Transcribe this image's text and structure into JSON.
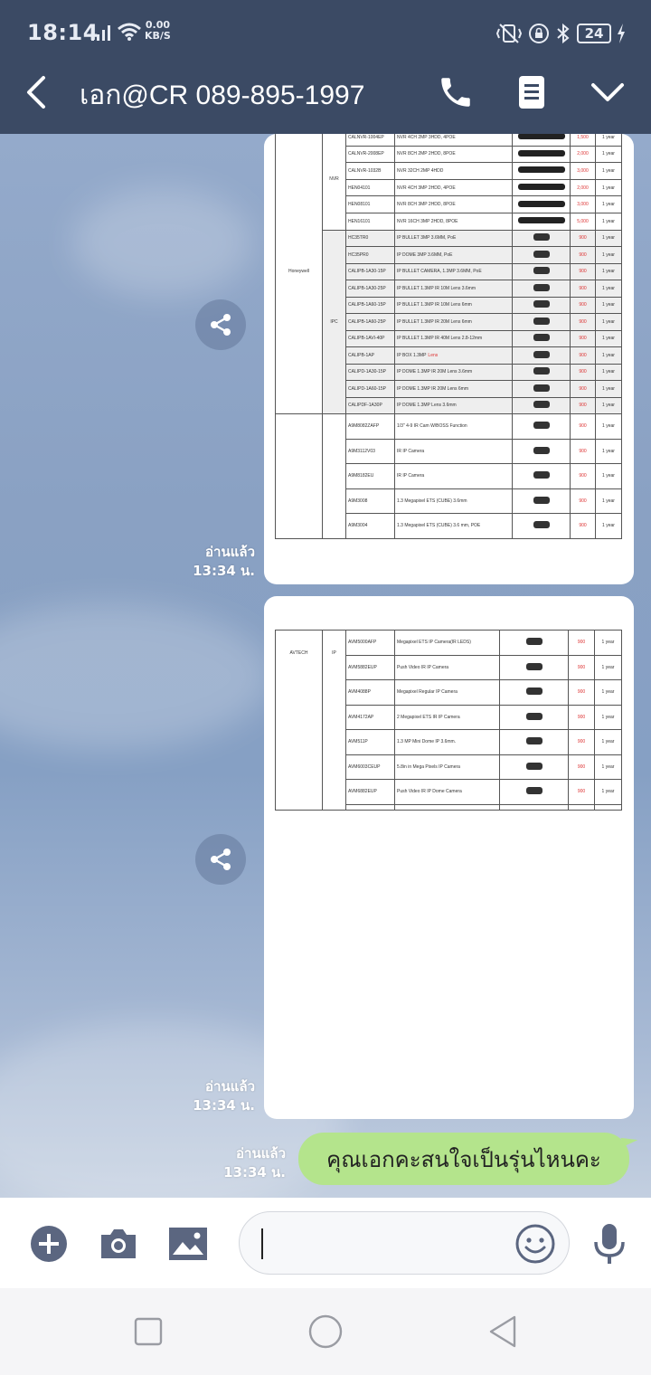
{
  "status": {
    "time": "18:14",
    "speed_value": "0.00",
    "speed_unit": "KB/S",
    "battery": "24"
  },
  "header": {
    "title": "เอก@CR 089-895-1997"
  },
  "messages": [
    {
      "type": "image",
      "read_label": "อ่านแล้ว",
      "time": "13:34 น.",
      "doc": {
        "brand": "Honeywell",
        "group_nvr": "NVR",
        "group_ipc": "IPC",
        "rows": [
          {
            "model": "CALNVR-1004EP",
            "desc": "NVR 4CH 2MP 3HDD, 4POE",
            "price": "1,500",
            "warranty": "1 year"
          },
          {
            "model": "CALNVR-2008EP",
            "desc": "NVR 8CH 2MP 2HDD, 8POE",
            "price": "2,000",
            "warranty": "1 year"
          },
          {
            "model": "CALNVR-1032B",
            "desc": "NVR 32CH 2MP 4HDD",
            "price": "3,000",
            "warranty": "1 year"
          },
          {
            "model": "HEN04101",
            "desc": "NVR 4CH 3MP 2HDD, 4POE",
            "price": "2,000",
            "warranty": "1 year"
          },
          {
            "model": "HEN08101",
            "desc": "NVR 8CH 3MP 2HDD, 8POE",
            "price": "3,000",
            "warranty": "1 year"
          },
          {
            "model": "HEN16101",
            "desc": "NVR 16CH 3MP 2HDD, 8POE",
            "price": "5,000",
            "warranty": "1 year"
          },
          {
            "model": "HC35TR0",
            "desc": "IP BULLET 3MP 3.6MM, PoE",
            "price": "900",
            "warranty": "1 year"
          },
          {
            "model": "HC35PR0",
            "desc": "IP DOME 3MP 3.6MM, PoE",
            "price": "900",
            "warranty": "1 year"
          },
          {
            "model": "CALIPB-1A30-15P",
            "desc": "IP BULLET CAMERA, 1.3MP 3.6MM, PoE",
            "price": "900",
            "warranty": "1 year"
          },
          {
            "model": "CALIPB-1A30-25P",
            "desc": "IP BULLET 1.3MP IR 10M Lens 3.6mm",
            "price": "900",
            "warranty": "1 year"
          },
          {
            "model": "CALIPB-1A60-15P",
            "desc": "IP BULLET 1.3MP IR 10M Lens 6mm",
            "price": "900",
            "warranty": "1 year"
          },
          {
            "model": "CALIPB-1A60-25P",
            "desc": "IP BULLET 1.3MP IR 20M Lens 6mm",
            "price": "900",
            "warranty": "1 year"
          },
          {
            "model": "CALIPB-1AVI-40P",
            "desc": "IP BULLET 1.3MP IR 40M Lens 2.8-12mm",
            "price": "900",
            "warranty": "1 year"
          },
          {
            "model": "CALIPB-1AP",
            "desc": "IP BOX 1.3MP",
            "desc_red": "Lens",
            "price": "900",
            "warranty": "1 year"
          },
          {
            "model": "CALIPD-1A30-15P",
            "desc": "IP DOME 1.3MP IR 20M Lens 3.6mm",
            "price": "900",
            "warranty": "1 year"
          },
          {
            "model": "CALIPD-1A60-15P",
            "desc": "IP DOME 1.3MP IR 20M Lens 6mm",
            "price": "900",
            "warranty": "1 year"
          },
          {
            "model": "CALIPDF-1A30P",
            "desc": "IP DOME 1.3MP Lens 3.6mm",
            "price": "900",
            "warranty": "1 year"
          },
          {
            "model": "A9M8082ZAFP",
            "desc": "1/3\" 4-9 IR Cam W/BOSS Function",
            "price": "900",
            "warranty": "1 year"
          },
          {
            "model": "A9M3112V03",
            "desc": "IR IP Camera",
            "price": "900",
            "warranty": "1 year"
          },
          {
            "model": "A9M8182EU",
            "desc": "IR IP Camera",
            "price": "900",
            "warranty": "1 year"
          },
          {
            "model": "A9M3008",
            "desc": "1.3 Megapixel ETS (CUBE) 3.6mm",
            "price": "900",
            "warranty": "1 year"
          },
          {
            "model": "A9M3004",
            "desc": "1.3 Megapixel ETS (CUBE) 3.6 mm, POE",
            "price": "900",
            "warranty": "1 year"
          }
        ]
      }
    },
    {
      "type": "image",
      "read_label": "อ่านแล้ว",
      "time": "13:34 น.",
      "doc": {
        "brand": "AVTECH",
        "group": "IP",
        "rows": [
          {
            "model": "AVM5000AFP",
            "desc": "Megapixel ETS IP Camera(IR LEDS)",
            "price": "900",
            "warranty": "1 year"
          },
          {
            "model": "AVM5882EUP",
            "desc": "Push Video IR IP Camera",
            "price": "900",
            "warranty": "1 year"
          },
          {
            "model": "AVM4088P",
            "desc": "Megapixel Regular IP Camera",
            "price": "900",
            "warranty": "1 year"
          },
          {
            "model": "AVM4172AP",
            "desc": "2 Megapixel ETS IR IP Camera",
            "price": "900",
            "warranty": "1 year"
          },
          {
            "model": "AVM511P",
            "desc": "1.3 MP Mini Dome IP 3.6mm.",
            "price": "900",
            "warranty": "1 year"
          },
          {
            "model": "AVM6003CEUP",
            "desc": "5.8in in Mega Pixels IP Camera",
            "price": "900",
            "warranty": "1 year"
          },
          {
            "model": "AVM6882EUP",
            "desc": "Push Video IR IP Dome Camera",
            "price": "900",
            "warranty": "1 year"
          }
        ]
      }
    },
    {
      "type": "text",
      "read_label": "อ่านแล้ว",
      "time": "13:34 น.",
      "text": "คุณเอกคะสนใจเป็นรุ่นไหนคะ"
    }
  ],
  "input": {
    "placeholder": "",
    "value": ""
  },
  "icons": {
    "back": "chevron-left-icon",
    "call": "phone-icon",
    "notes": "note-icon",
    "menu": "chevron-down-icon",
    "share": "share-icon",
    "add": "plus-circle-icon",
    "camera": "camera-icon",
    "gallery": "image-icon",
    "emoji": "smiley-icon",
    "mic": "microphone-icon"
  },
  "colors": {
    "header_bg": "#3b4a64",
    "bubble_green": "#b4e48c",
    "chat_bg": "#8fa6c8"
  }
}
